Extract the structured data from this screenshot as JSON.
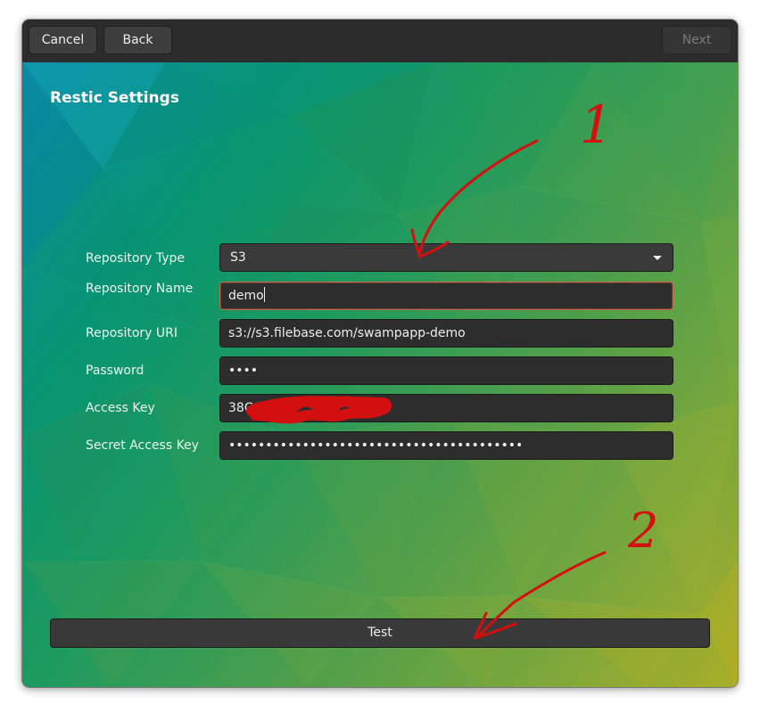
{
  "header": {
    "cancel_label": "Cancel",
    "back_label": "Back",
    "next_label": "Next"
  },
  "page": {
    "title": "Restic Settings"
  },
  "form": {
    "repository_type": {
      "label": "Repository Type",
      "value": "S3"
    },
    "repository_name": {
      "label": "Repository Name",
      "value": "demo"
    },
    "repository_uri": {
      "label": "Repository URI",
      "value": "s3://s3.filebase.com/swampapp-demo"
    },
    "password": {
      "label": "Password",
      "value": "••••"
    },
    "access_key": {
      "label": "Access Key",
      "value": "38C6"
    },
    "secret_access_key": {
      "label": "Secret Access Key",
      "value": "••••••••••••••••••••••••••••••••••••••••"
    }
  },
  "actions": {
    "test_label": "Test"
  },
  "annotations": {
    "marker_1": "1",
    "marker_2": "2",
    "ink_color": "#d40f0f"
  },
  "colors": {
    "field_background": "#2d2d2d",
    "focus_border": "#c66a48",
    "titlebar": "#2c2c2c"
  }
}
